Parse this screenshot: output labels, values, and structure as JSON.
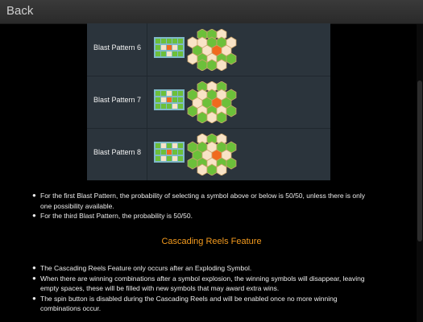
{
  "header": {
    "back_label": "Back"
  },
  "blast_patterns": [
    {
      "label": "Blast Pattern 6"
    },
    {
      "label": "Blast Pattern 7"
    },
    {
      "label": "Blast Pattern 8"
    }
  ],
  "blast_notes": [
    "For the first Blast Pattern, the probability of selecting a symbol above or below is 50/50, unless there is only one possibility available.",
    "For the third Blast Pattern, the probability is 50/50."
  ],
  "cascading": {
    "title": "Cascading Reels Feature",
    "notes": [
      "The Cascading Reels Feature only occurs after an Exploding Symbol.",
      "When there are winning combinations after a symbol explosion, the winning symbols will disappear, leaving empty spaces, these will be filled with new symbols that may award extra wins.",
      "The spin button is disabled during the Cascading Reels and will be enabled once no more winning combinations occur."
    ]
  },
  "colors": {
    "accent": "#f39a1e",
    "hex_green": "#6cc03a",
    "hex_orange": "#f06a1e",
    "hex_cream": "#f8e3c6"
  }
}
